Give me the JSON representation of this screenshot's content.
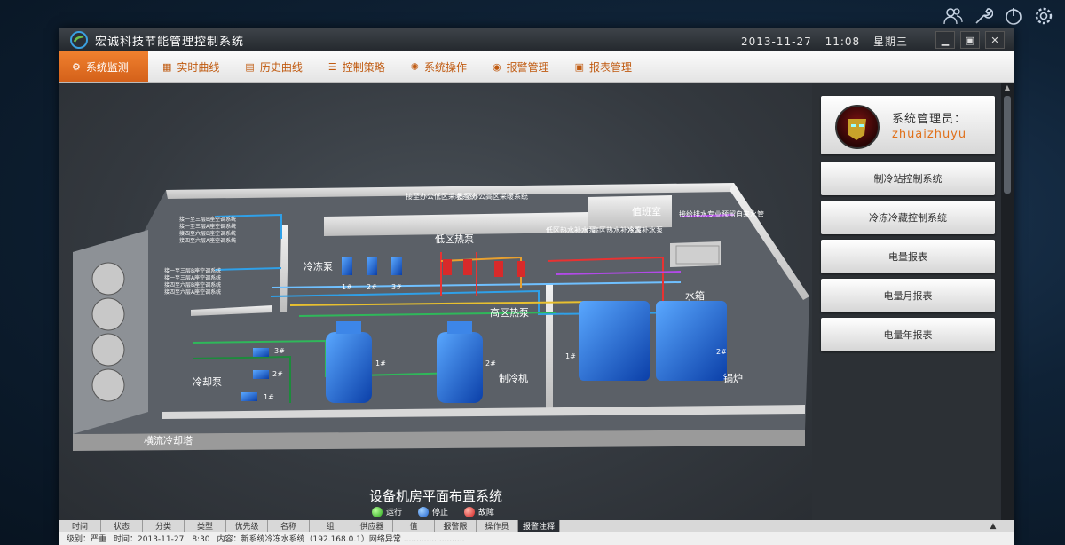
{
  "window": {
    "title": "宏诚科技节能管理控制系统",
    "date": "2013-11-27",
    "time": "11:08",
    "weekday": "星期三"
  },
  "menu": [
    {
      "label": "系统监测",
      "icon": "monitor-icon",
      "active": true
    },
    {
      "label": "实时曲线",
      "icon": "chart-icon"
    },
    {
      "label": "历史曲线",
      "icon": "history-icon"
    },
    {
      "label": "控制策略",
      "icon": "list-icon"
    },
    {
      "label": "系统操作",
      "icon": "gear-icon"
    },
    {
      "label": "报警管理",
      "icon": "alarm-icon"
    },
    {
      "label": "报表管理",
      "icon": "report-icon"
    }
  ],
  "user": {
    "role": "系统管理员：",
    "name": "zhuaizhuyu"
  },
  "sidebar_buttons": [
    "制冷站控制系统",
    "冷冻冷藏控制系统",
    "电量报表",
    "电量月报表",
    "电量年报表"
  ],
  "plan": {
    "title": "设备机房平面布置系统",
    "labels": {
      "chilled_pump": "冷冻泵",
      "low_heat_pump": "低区热泵",
      "high_heat_pump": "高区热泵",
      "chiller": "制冷机",
      "cooling_pump": "冷却泵",
      "cooling_tower": "横流冷却塔",
      "boiler": "锅炉",
      "water_tank": "水箱",
      "duty_room": "值班室",
      "low_makeup": "低区热水补水泵",
      "high_makeup": "高区热水补水泵",
      "cold_makeup": "冷冻补水泵",
      "office_low": "接至办公低区采暖系统",
      "office_high": "接至办公高区采暖系统",
      "drain": "接给排水专业预留自来水管",
      "ac_1": "接一至三层B座空调系统",
      "ac_2": "接一至三层A座空调系统",
      "ac_3": "接四至六层B座空调系统",
      "ac_4": "接四至六层A座空调系统",
      "ac_5": "接一至三层B座空调系统",
      "ac_6": "接一至三层A座空调系统",
      "ac_7": "接四至六层B座空调系统",
      "ac_8": "接四至六层A座空调系统"
    },
    "unit_labels": {
      "n1": "1#",
      "n2": "2#",
      "n3": "3#"
    }
  },
  "legend": [
    {
      "label": "运行",
      "color": "#24a315"
    },
    {
      "label": "停止",
      "color": "#1a5fd0"
    },
    {
      "label": "故障",
      "color": "#d01a1a"
    }
  ],
  "alarm_columns": [
    "时间",
    "状态",
    "分类",
    "类型",
    "优先级",
    "名称",
    "组",
    "供应器",
    "值",
    "报警限",
    "操作员",
    "报警注释"
  ],
  "alarm_row": {
    "level": "级别：严重",
    "time": "时间：2013-11-27　8:30",
    "content": "内容：新系统冷冻水系统（192.168.0.1）网络异常 ........................"
  },
  "colors": {
    "accent": "#e0701a",
    "menu_text": "#c05a10"
  }
}
